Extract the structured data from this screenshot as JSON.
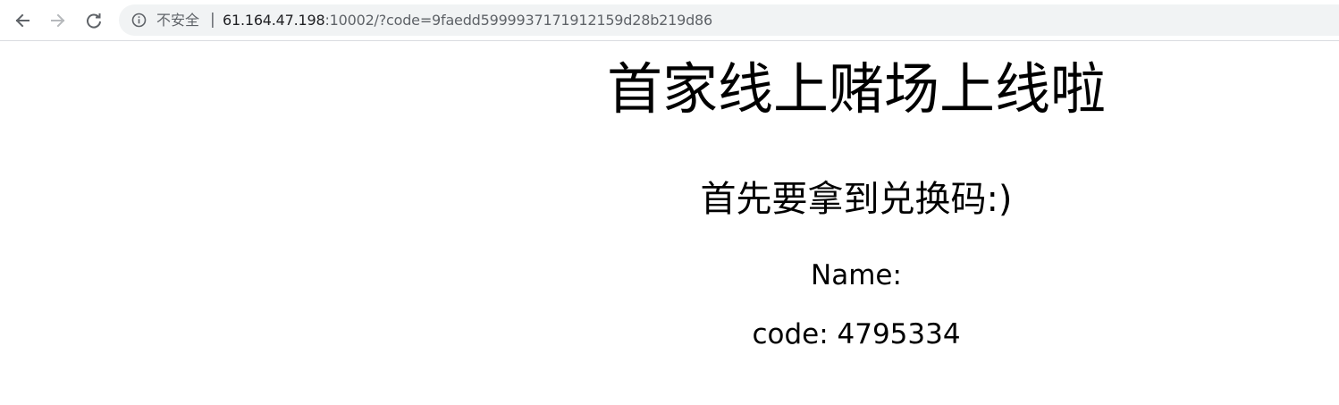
{
  "browser": {
    "security_label": "不安全",
    "separator": "|",
    "url_host": "61.164.47.198",
    "url_rest": ":10002/?code=9faedd5999937171912159d28b219d86",
    "icons": {
      "back": "arrow-left-icon",
      "forward": "arrow-right-icon",
      "reload": "reload-icon",
      "info": "info-circle-icon"
    }
  },
  "page": {
    "title": "首家线上赌场上线啦",
    "subtitle": "首先要拿到兑换码:)",
    "name_line": "Name:",
    "code_line": "code: 4795334"
  }
}
